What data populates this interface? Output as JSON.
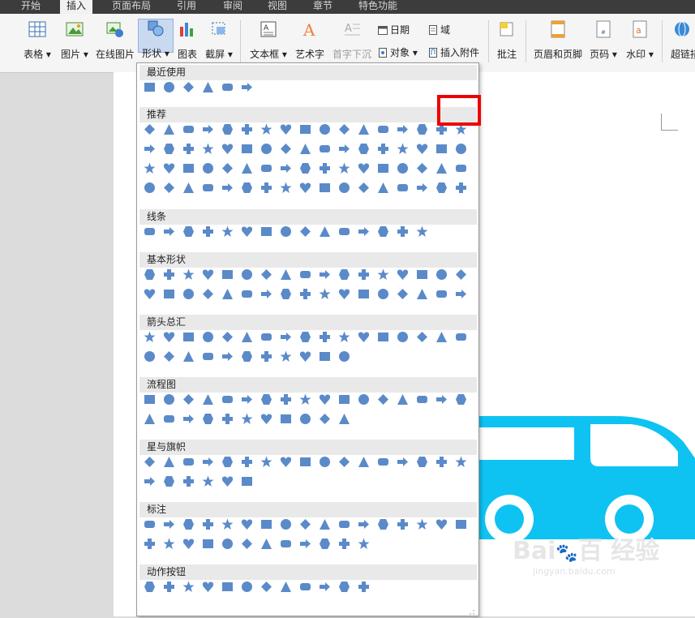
{
  "tabs": [
    "开始",
    "插入",
    "页面布局",
    "引用",
    "审阅",
    "视图",
    "章节",
    "特色功能"
  ],
  "active_tab": "插入",
  "ribbon": {
    "table": "表格",
    "picture": "图片",
    "online_picture": "在线图片",
    "shapes": "形状",
    "chart": "图表",
    "screenshot": "截屏",
    "textbox": "文本框",
    "wordart": "艺术字",
    "dropcap": "首字下沉",
    "date": "日期",
    "field": "域",
    "object": "对象",
    "attachment": "插入附件",
    "comment": "批注",
    "header_footer": "页眉和页脚",
    "page_number": "页码",
    "watermark": "水印",
    "hyperlink": "超链接"
  },
  "gallery": {
    "sections": [
      "最近使用",
      "推荐",
      "线条",
      "基本形状",
      "箭头总汇",
      "流程图",
      "星与旗帜",
      "标注",
      "动作按钮"
    ],
    "more_button": "···"
  },
  "watermark": {
    "brand": "Bai",
    "brand_tail": "百",
    "site": "经验",
    "url": "jingyan.baidu.com"
  },
  "colors": {
    "shape_blue": "#5b8ac9",
    "bus_cyan": "#0ec3f2",
    "highlight_red": "#ee0000"
  }
}
